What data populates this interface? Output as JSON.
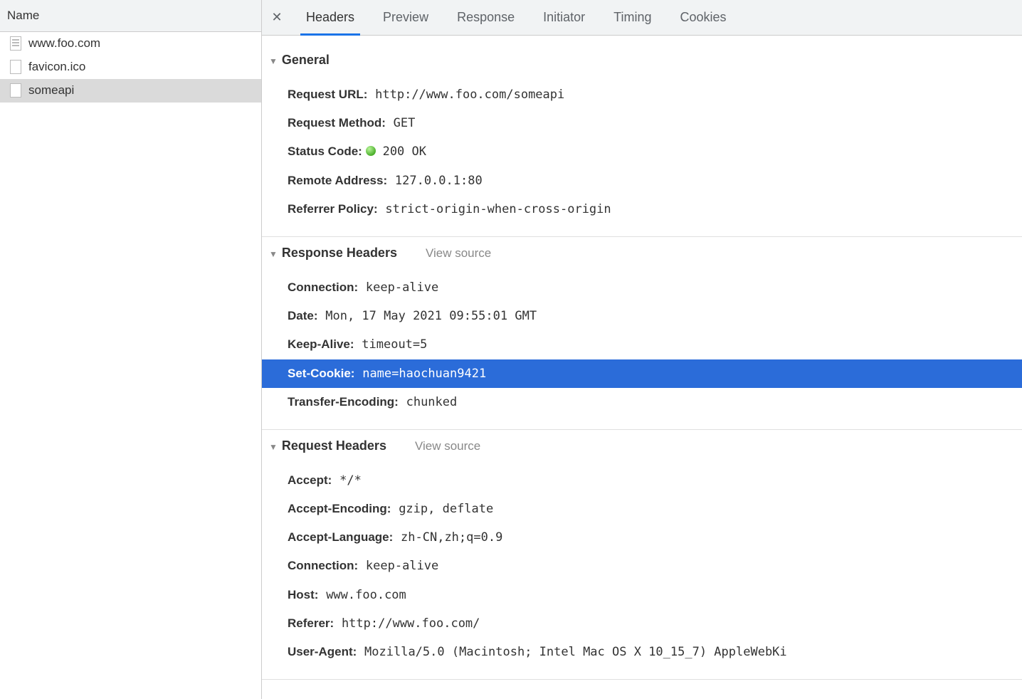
{
  "sidebar": {
    "header": "Name",
    "items": [
      {
        "name": "www.foo.com",
        "icon": "doc",
        "selected": false
      },
      {
        "name": "favicon.ico",
        "icon": "blank",
        "selected": false
      },
      {
        "name": "someapi",
        "icon": "blank",
        "selected": true
      }
    ]
  },
  "tabs": {
    "close_symbol": "✕",
    "items": [
      {
        "label": "Headers",
        "active": true
      },
      {
        "label": "Preview",
        "active": false
      },
      {
        "label": "Response",
        "active": false
      },
      {
        "label": "Initiator",
        "active": false
      },
      {
        "label": "Timing",
        "active": false
      },
      {
        "label": "Cookies",
        "active": false
      }
    ]
  },
  "sections": {
    "general": {
      "title": "General",
      "rows": [
        {
          "key": "Request URL:",
          "val": "http://www.foo.com/someapi"
        },
        {
          "key": "Request Method:",
          "val": "GET"
        },
        {
          "key": "Status Code:",
          "val": "200 OK",
          "status_dot": true
        },
        {
          "key": "Remote Address:",
          "val": "127.0.0.1:80"
        },
        {
          "key": "Referrer Policy:",
          "val": "strict-origin-when-cross-origin"
        }
      ]
    },
    "response_headers": {
      "title": "Response Headers",
      "view_source": "View source",
      "rows": [
        {
          "key": "Connection:",
          "val": "keep-alive"
        },
        {
          "key": "Date:",
          "val": "Mon, 17 May 2021 09:55:01 GMT"
        },
        {
          "key": "Keep-Alive:",
          "val": "timeout=5"
        },
        {
          "key": "Set-Cookie:",
          "val": "name=haochuan9421",
          "highlighted": true
        },
        {
          "key": "Transfer-Encoding:",
          "val": "chunked"
        }
      ]
    },
    "request_headers": {
      "title": "Request Headers",
      "view_source": "View source",
      "rows": [
        {
          "key": "Accept:",
          "val": "*/*"
        },
        {
          "key": "Accept-Encoding:",
          "val": "gzip, deflate"
        },
        {
          "key": "Accept-Language:",
          "val": "zh-CN,zh;q=0.9"
        },
        {
          "key": "Connection:",
          "val": "keep-alive"
        },
        {
          "key": "Host:",
          "val": "www.foo.com"
        },
        {
          "key": "Referer:",
          "val": "http://www.foo.com/"
        },
        {
          "key": "User-Agent:",
          "val": "Mozilla/5.0 (Macintosh; Intel Mac OS X 10_15_7) AppleWebKi"
        }
      ]
    }
  }
}
